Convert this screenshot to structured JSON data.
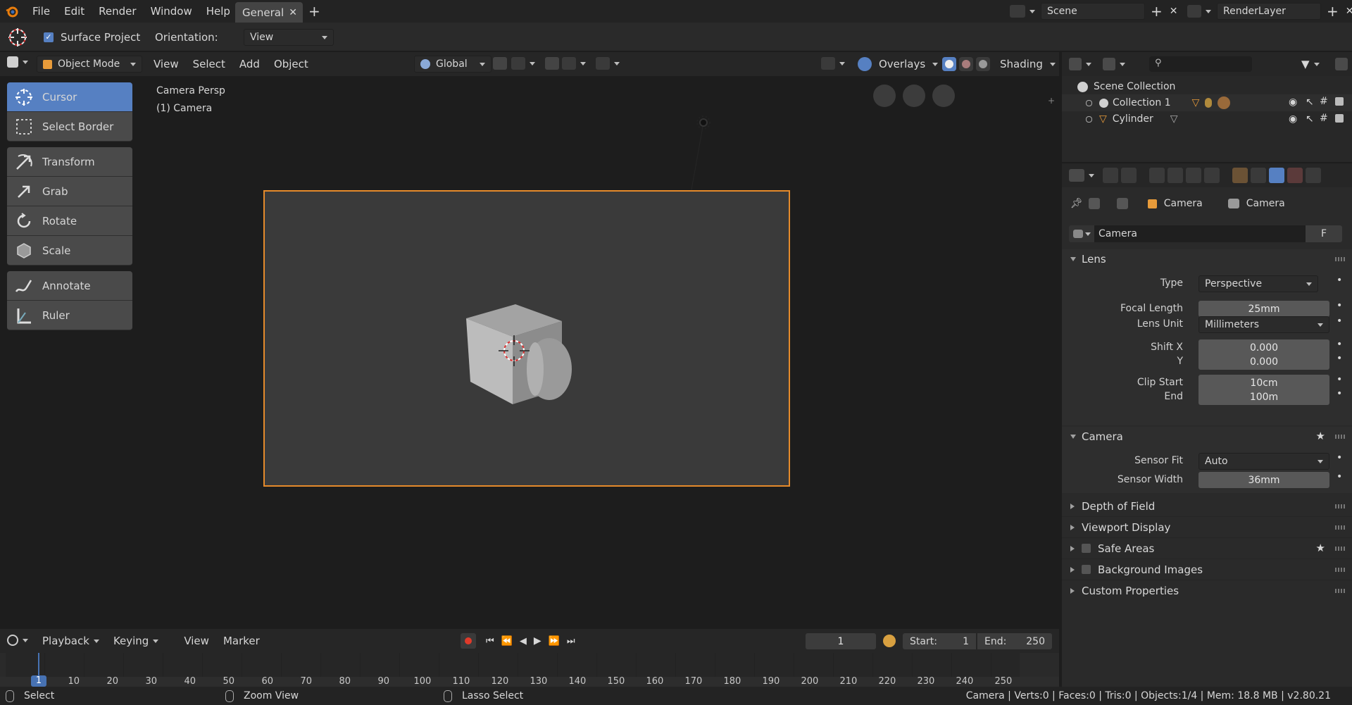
{
  "topbar": {
    "menus": [
      "File",
      "Edit",
      "Render",
      "Window",
      "Help"
    ],
    "workspace_tab": "General",
    "scene": "Scene",
    "render_layer": "RenderLayer"
  },
  "tool_header": {
    "surface_project": "Surface Project",
    "orientation_label": "Orientation:",
    "orientation_value": "View"
  },
  "viewport_header": {
    "mode": "Object Mode",
    "menus": [
      "View",
      "Select",
      "Add",
      "Object"
    ],
    "transform_space": "Global",
    "overlays": "Overlays",
    "shading": "Shading"
  },
  "viewport": {
    "view_name": "Camera Persp",
    "object_name": "(1) Camera"
  },
  "toolbar": {
    "tools": [
      "Cursor",
      "Select Border",
      "Transform",
      "Grab",
      "Rotate",
      "Scale",
      "Annotate",
      "Ruler"
    ]
  },
  "outliner": {
    "root": "Scene Collection",
    "items": [
      "Collection 1",
      "Cylinder"
    ]
  },
  "properties": {
    "breadcrumb_object": "Camera",
    "breadcrumb_data": "Camera",
    "datablock_name": "Camera",
    "fake_user": "F",
    "lens": {
      "title": "Lens",
      "type_label": "Type",
      "type_value": "Perspective",
      "focal_label": "Focal Length",
      "focal_value": "25mm",
      "unit_label": "Lens Unit",
      "unit_value": "Millimeters",
      "shiftx_label": "Shift X",
      "shiftx_value": "0.000",
      "shifty_label": "Y",
      "shifty_value": "0.000",
      "clipstart_label": "Clip Start",
      "clipstart_value": "10cm",
      "clipend_label": "End",
      "clipend_value": "100m"
    },
    "camera": {
      "title": "Camera",
      "fit_label": "Sensor Fit",
      "fit_value": "Auto",
      "width_label": "Sensor Width",
      "width_value": "36mm"
    },
    "collapsed": [
      "Depth of Field",
      "Viewport Display",
      "Safe Areas",
      "Background Images",
      "Custom Properties"
    ]
  },
  "timeline": {
    "menus": [
      "Playback",
      "Keying",
      "View",
      "Marker"
    ],
    "current_frame": "1",
    "start_label": "Start:",
    "start_value": "1",
    "end_label": "End:",
    "end_value": "250",
    "ticks": [
      "1",
      "10",
      "20",
      "30",
      "40",
      "50",
      "60",
      "70",
      "80",
      "90",
      "100",
      "110",
      "120",
      "130",
      "140",
      "150",
      "160",
      "170",
      "180",
      "190",
      "200",
      "210",
      "220",
      "230",
      "240",
      "250"
    ]
  },
  "statusbar": {
    "select": "Select",
    "zoom": "Zoom View",
    "lasso": "Lasso Select",
    "stats": "Camera | Verts:0 | Faces:0 | Tris:0 | Objects:1/4 | Mem: 18.8 MB | v2.80.21"
  },
  "colors": {
    "accent_blue": "#5680c2",
    "camera_frame": "#e58a2b",
    "frame_marker": "#4772b3"
  }
}
